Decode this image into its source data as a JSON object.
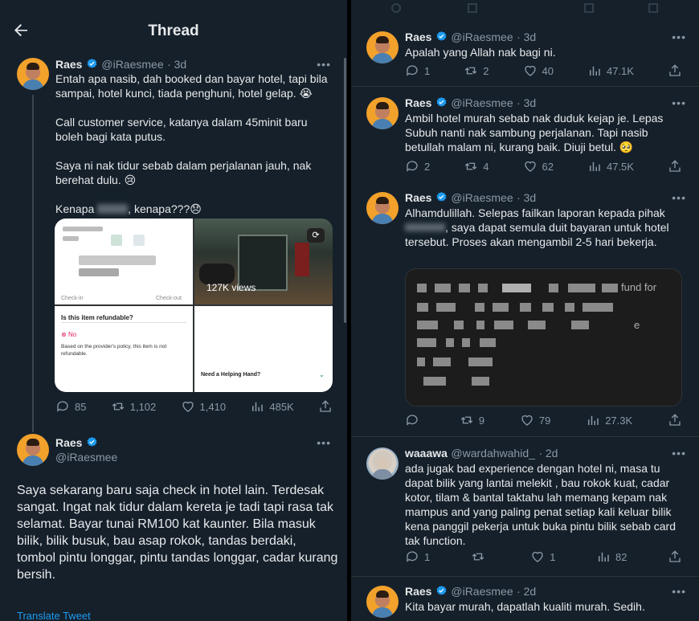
{
  "header": {
    "title": "Thread"
  },
  "left_panel": {
    "main_tweet": {
      "name": "Raes",
      "handle": "@iRaesmee",
      "time": "· 3d",
      "text": "Entah apa nasib, dah booked dan bayar hotel, tapi bila sampai, hotel kunci, tiada penghuni, hotel gelap. 😭\n\nCall customer service, katanya dalam 45minit baru boleh bagi kata putus.\n\nSaya ni nak tidur sebab dalam perjalanan jauh, nak berehat dulu. 😢\n\nKenapa ",
      "text_end": ", kenapa???😞",
      "media": {
        "views": "127K views",
        "check_in": "Check-in",
        "check_out": "Check-out",
        "refund_q": "Is this item refundable?",
        "refund_no": "No",
        "refund_note": "Based on the provider's policy, this item is not refundable.",
        "help": "Need a Helping Hand?"
      },
      "stats": {
        "replies": "85",
        "retweets": "1,102",
        "likes": "1,410",
        "views": "485K"
      }
    },
    "second_tweet": {
      "name": "Raes",
      "handle": "@iRaesmee",
      "text": "Saya sekarang baru saja check in hotel lain. Terdesak sangat. Ingat nak tidur dalam kereta je tadi tapi rasa tak selamat. Bayar tunai RM100 kat kaunter. Bila masuk bilik, bilik busuk, bau asap rokok, tandas berdaki, tombol pintu longgar, pintu tandas longgar, cadar kurang bersih.",
      "translate": "Translate Tweet"
    }
  },
  "right_panel": {
    "tweets": [
      {
        "name": "Raes",
        "handle": "@iRaesmee",
        "time": "· 3d",
        "text": "Apalah yang Allah nak bagi ni.",
        "stats": {
          "replies": "1",
          "retweets": "2",
          "likes": "40",
          "views": "47.1K"
        }
      },
      {
        "name": "Raes",
        "handle": "@iRaesmee",
        "time": "· 3d",
        "text": "Ambil hotel murah sebab nak duduk kejap je. Lepas Subuh nanti nak sambung perjalanan. Tapi nasib betullah malam ni, kurang baik. Diuji betul. 🥺",
        "stats": {
          "replies": "2",
          "retweets": "4",
          "likes": "62",
          "views": "47.5K"
        }
      },
      {
        "name": "Raes",
        "handle": "@iRaesmee",
        "time": "· 3d",
        "text": "Alhamdulillah. Selepas failkan laporan kepada pihak",
        "text_2": ", saya dapat semula duit bayaran untuk hotel tersebut. Proses akan mengambil 2-5 hari bekerja.",
        "card_fragment_1": "fund for",
        "card_fragment_2": "e",
        "stats": {
          "replies": "",
          "retweets": "9",
          "likes": "79",
          "views": "27.3K"
        }
      },
      {
        "name": "waaawa",
        "handle": "@wardahwahid_",
        "time": "· 2d",
        "text": "ada jugak bad experience dengan hotel ni, masa tu dapat bilik yang lantai melekit , bau rokok kuat, cadar kotor, tilam & bantal taktahu lah memang kepam nak mampus and yang paling penat setiap kali keluar bilik kena panggil pekerja untuk buka pintu bilik sebab card tak function.",
        "stats": {
          "replies": "1",
          "retweets": "",
          "likes": "1",
          "views": "82"
        }
      },
      {
        "name": "Raes",
        "handle": "@iRaesmee",
        "time": "· 2d",
        "text": "Kita bayar murah, dapatlah kualiti murah. Sedih."
      }
    ]
  },
  "colors": {
    "bg": "#15202b",
    "text": "#e7e9ea",
    "muted": "#8b98a5",
    "verified": "#1d9bf0",
    "link": "#1d9bf0",
    "refund_no": "#e0245e"
  }
}
